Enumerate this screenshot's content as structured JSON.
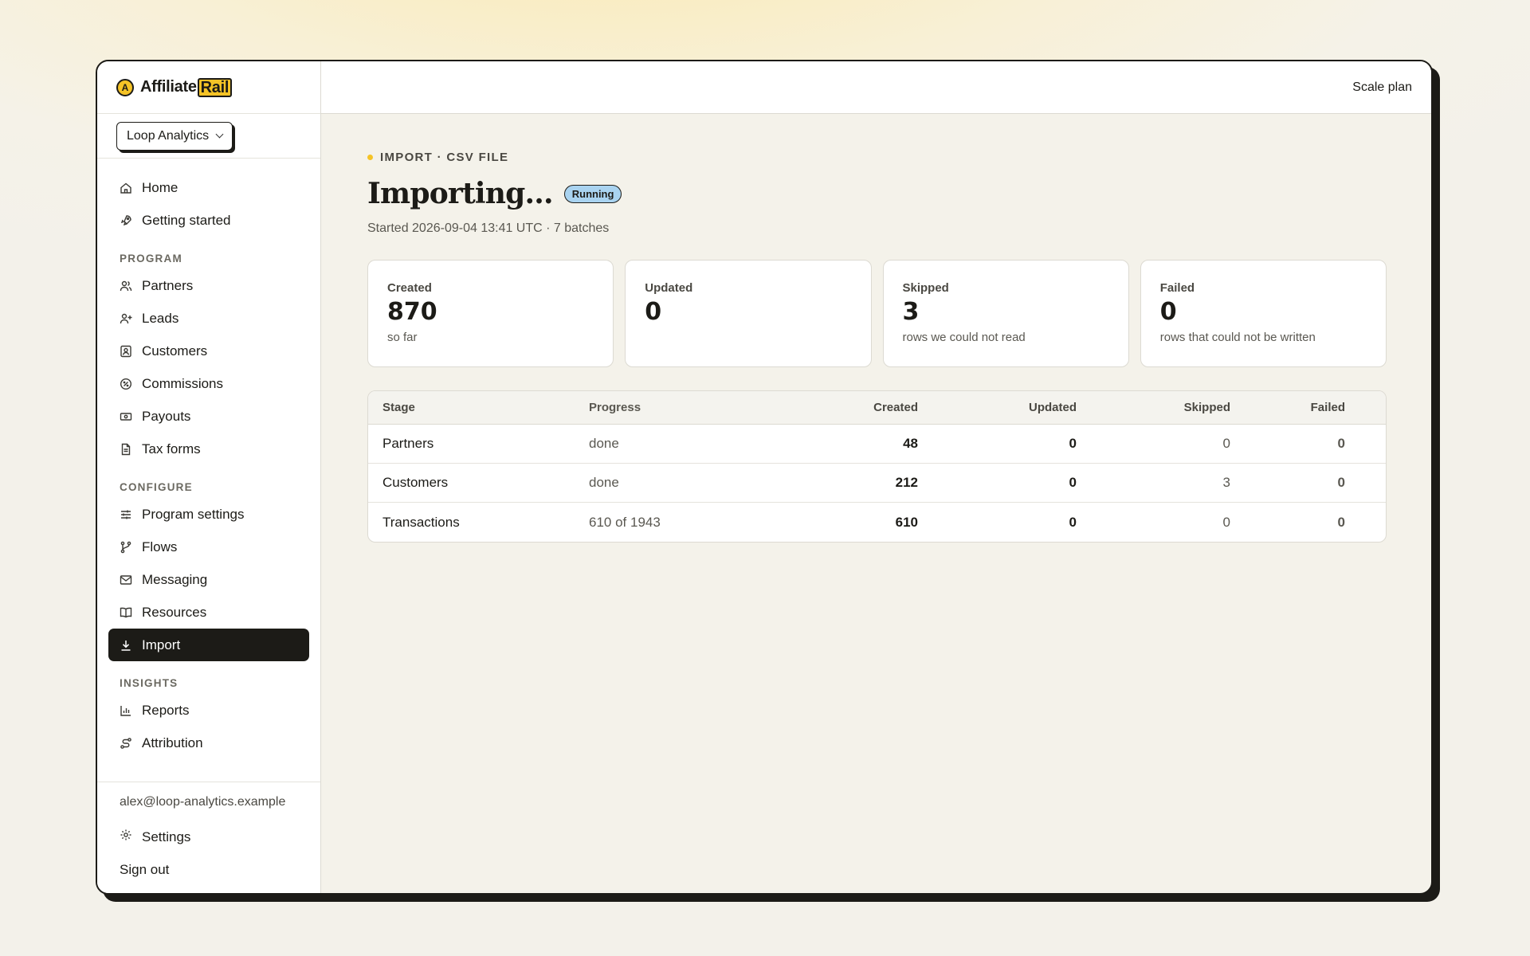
{
  "brand": {
    "name_part1": "Affiliate",
    "name_part2": "Rail",
    "mark": "A"
  },
  "org_selector": {
    "label": "Loop Analytics"
  },
  "nav": {
    "top": [
      {
        "label": "Home",
        "icon": "home-icon"
      },
      {
        "label": "Getting started",
        "icon": "rocket-icon"
      }
    ],
    "sections": [
      {
        "title": "PROGRAM",
        "items": [
          {
            "label": "Partners",
            "icon": "users-icon"
          },
          {
            "label": "Leads",
            "icon": "user-plus-icon"
          },
          {
            "label": "Customers",
            "icon": "contact-icon"
          },
          {
            "label": "Commissions",
            "icon": "percent-icon"
          },
          {
            "label": "Payouts",
            "icon": "banknote-icon"
          },
          {
            "label": "Tax forms",
            "icon": "file-icon"
          }
        ]
      },
      {
        "title": "CONFIGURE",
        "items": [
          {
            "label": "Program settings",
            "icon": "sliders-icon"
          },
          {
            "label": "Flows",
            "icon": "branch-icon"
          },
          {
            "label": "Messaging",
            "icon": "mail-icon"
          },
          {
            "label": "Resources",
            "icon": "book-icon"
          },
          {
            "label": "Import",
            "icon": "download-icon",
            "active": true
          }
        ]
      },
      {
        "title": "INSIGHTS",
        "items": [
          {
            "label": "Reports",
            "icon": "bar-chart-icon"
          },
          {
            "label": "Attribution",
            "icon": "route-icon"
          }
        ]
      }
    ]
  },
  "footer": {
    "email": "alex@loop-analytics.example",
    "settings": "Settings",
    "sign_out": "Sign out"
  },
  "topbar": {
    "plan": "Scale plan"
  },
  "page": {
    "eyebrow": "IMPORT · CSV FILE",
    "title": "Importing...",
    "status_badge": "Running",
    "subtitle": "Started 2026-09-04 13:41 UTC · 7 batches"
  },
  "stats": [
    {
      "label": "Created",
      "value": "870",
      "note": "so far"
    },
    {
      "label": "Updated",
      "value": "0",
      "note": ""
    },
    {
      "label": "Skipped",
      "value": "3",
      "note": "rows we could not read"
    },
    {
      "label": "Failed",
      "value": "0",
      "note": "rows that could not be written"
    }
  ],
  "table": {
    "columns": [
      "Stage",
      "Progress",
      "Created",
      "Updated",
      "Skipped",
      "Failed"
    ],
    "rows": [
      [
        "Partners",
        "done",
        "48",
        "0",
        "0",
        "0"
      ],
      [
        "Customers",
        "done",
        "212",
        "0",
        "3",
        "0"
      ],
      [
        "Transactions",
        "610 of 1943",
        "610",
        "0",
        "0",
        "0"
      ]
    ]
  },
  "colors": {
    "accent": "#f5c326",
    "dark": "#1c1b17",
    "badge": "#a9d3f0"
  }
}
